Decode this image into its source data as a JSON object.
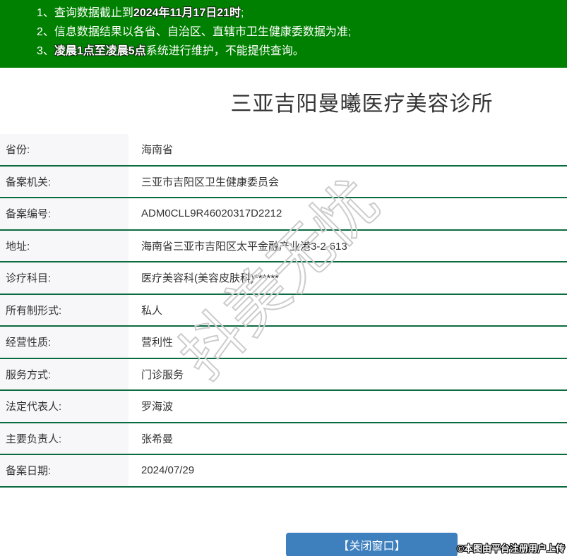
{
  "notice_bar": {
    "bg_color": "#008000",
    "items": [
      {
        "num": "1、",
        "pre": "查询数据截止到",
        "bold": "2024年11月17日21时",
        "post": ";"
      },
      {
        "num": "2、",
        "pre": "信息数据结果以各省、自治区、直辖市卫生健康委数据为准;",
        "bold": "",
        "post": ""
      },
      {
        "num": "3、",
        "pre": "",
        "bold": "凌晨1点至凌晨5点",
        "post": "系统进行维护，不能提供查询。"
      }
    ]
  },
  "page": {
    "title": "三亚吉阳曼曦医疗美容诊所"
  },
  "record_table": {
    "rows": [
      {
        "label": "省份:",
        "value": "海南省"
      },
      {
        "label": "备案机关:",
        "value": "三亚市吉阳区卫生健康委员会"
      },
      {
        "label": "备案编号:",
        "value": "ADM0CLL9R46020317D2212"
      },
      {
        "label": "地址:",
        "value": "海南省三亚市吉阳区太平金融产业港3-2-613"
      },
      {
        "label": "诊疗科目:",
        "value": "医疗美容科(美容皮肤科)******"
      },
      {
        "label": "所有制形式:",
        "value": "私人"
      },
      {
        "label": "经营性质:",
        "value": "营利性"
      },
      {
        "label": "服务方式:",
        "value": "门诊服务"
      },
      {
        "label": "法定代表人:",
        "value": "罗海波"
      },
      {
        "label": "主要负责人:",
        "value": "张希曼"
      },
      {
        "label": "备案日期:",
        "value": "2024/07/29"
      }
    ]
  },
  "watermark": {
    "diagonal_text": "抖美无忧",
    "copyright_text": "©本图由平台注册用户上传"
  },
  "footer": {
    "close_button_label": "【关闭窗口】"
  },
  "colors": {
    "notice_green": "#008000",
    "row_separator_green": "#0a6b3f",
    "label_cell_bg": "#f7f7f9",
    "button_blue": "#3e7fbe",
    "text_dark": "#333333",
    "watermark_gray": "#cccccc"
  }
}
